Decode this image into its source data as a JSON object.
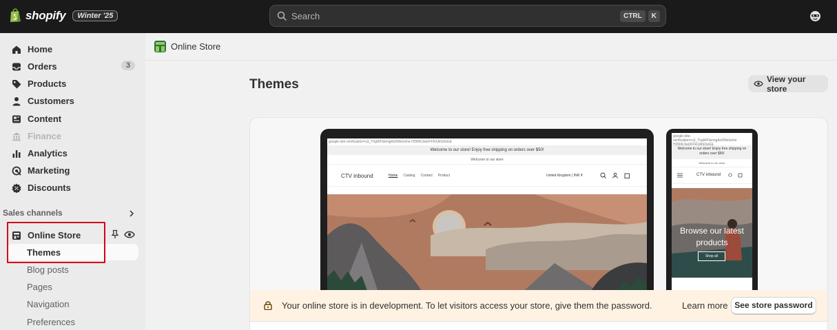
{
  "topbar": {
    "brand": "shopify",
    "edition_badge": "Winter '25",
    "search_placeholder": "Search",
    "shortcut_keys": [
      "CTRL",
      "K"
    ],
    "profile_icon": "user-circle-icon"
  },
  "sidebar": {
    "items": [
      {
        "label": "Home",
        "icon": "home-icon"
      },
      {
        "label": "Orders",
        "icon": "inbox-icon",
        "badge": "3"
      },
      {
        "label": "Products",
        "icon": "tag-icon"
      },
      {
        "label": "Customers",
        "icon": "person-icon"
      },
      {
        "label": "Content",
        "icon": "content-icon"
      },
      {
        "label": "Finance",
        "icon": "bank-icon",
        "disabled": true
      },
      {
        "label": "Analytics",
        "icon": "bar-chart-icon"
      },
      {
        "label": "Marketing",
        "icon": "target-icon"
      },
      {
        "label": "Discounts",
        "icon": "discount-icon"
      }
    ],
    "sales_channels_label": "Sales channels",
    "online_store": {
      "label": "Online Store",
      "sub_items": [
        "Themes",
        "Blog posts",
        "Pages",
        "Navigation",
        "Preferences"
      ],
      "active_sub_item": "Themes"
    }
  },
  "main": {
    "breadcrumb": "Online Store",
    "page_title": "Themes",
    "view_store_label": "View your store",
    "preview": {
      "verification_text": "google-site-verification=u3_ThgWFlsimqjAo0WeUehe H2M4L9aUFFR1Aht2wGE",
      "announcement_primary": "Welcome to our store! Enjoy free shipping on orders over $50!",
      "announcement_secondary": "Welcome to our store",
      "store_name": "CTV inbound",
      "nav_links": [
        "Home",
        "Catalog",
        "Contact",
        "Product"
      ],
      "country_selector": "United Kingdom | INR ₹",
      "mobile_verification_text": "google-site-verification=u3_ThgWFlsimqjAo0WeUehe H2M4L9aUFFR1Aht2wGE",
      "mobile_announcement_primary": "Welcome to our store! Enjoy free shipping on orders over $50!",
      "mobile_announcement_secondary": "Welcome to our store",
      "mobile_hero_text": "Browse our latest products",
      "mobile_hero_button": "Shop all"
    },
    "notice": {
      "text": "Your online store is in development. To let visitors access your store, give them the password.",
      "learn_more": "Learn more",
      "password_button": "See store password"
    }
  },
  "colors": {
    "topbar_bg": "#1a1a1a",
    "sidebar_bg": "#ebebeb",
    "notice_bg": "#fff2e3",
    "highlight_box": "#d0021b"
  }
}
